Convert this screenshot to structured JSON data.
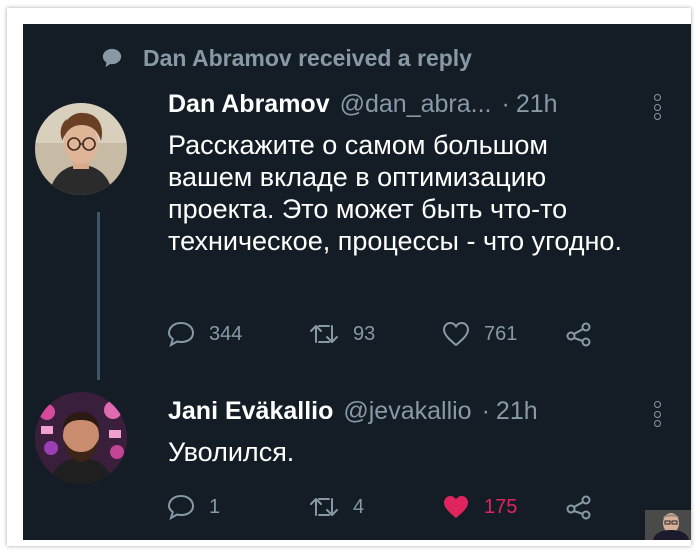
{
  "notification": {
    "text": "Dan Abramov received a reply",
    "icon": "speech-bubble-icon"
  },
  "tweets": [
    {
      "author": "Dan Abramov",
      "handle": "@dan_abra...",
      "separator": "·",
      "time": "21h",
      "body": "Расскажите о самом большом вашем вкладе в оптимизацию проекта. Это может быть что-то техническое, процессы - что угодно.",
      "replies": "344",
      "retweets": "93",
      "likes": "761"
    },
    {
      "author": "Jani Eväkallio",
      "handle": "@jevakallio",
      "separator": "·",
      "time": "21h",
      "body": "Уволился.",
      "replies": "1",
      "retweets": "4",
      "likes": "175",
      "liked": true
    }
  ],
  "colors": {
    "background": "#141d26",
    "text": "#ffffff",
    "muted": "#8899a6",
    "like": "#e0245e"
  }
}
